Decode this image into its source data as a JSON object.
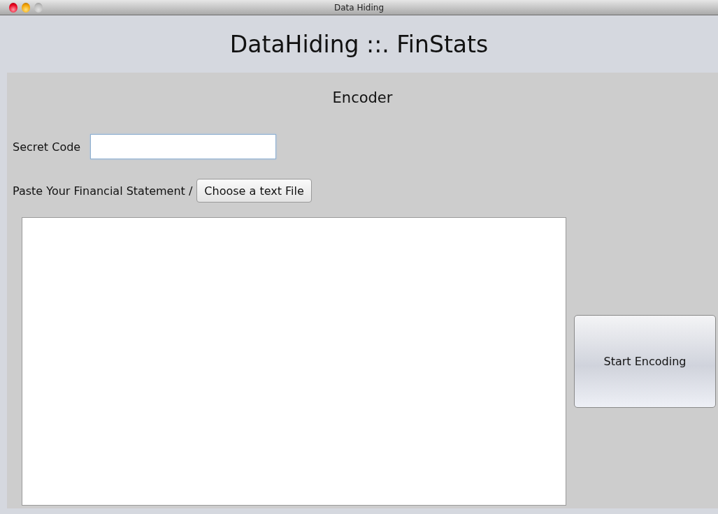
{
  "window": {
    "title": "Data Hiding"
  },
  "header": {
    "title": "DataHiding ::. FinStats"
  },
  "panel": {
    "title": "Encoder",
    "secret_code": {
      "label": "Secret Code"
    },
    "file_row": {
      "label": "Paste Your Financial Statement /",
      "button": "Choose a text File"
    },
    "start_button": "Start Encoding"
  }
}
